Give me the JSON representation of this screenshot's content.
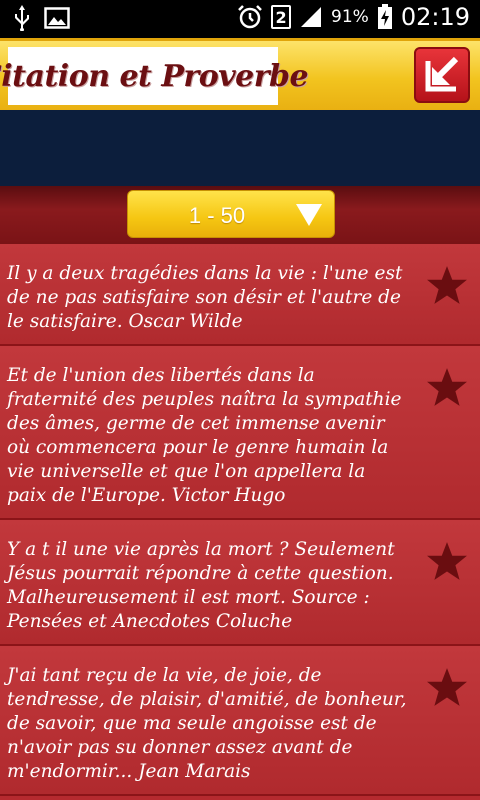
{
  "status_bar": {
    "battery": "91%",
    "time": "02:19",
    "sim": "2"
  },
  "header": {
    "logo_text": "Citation et Proverbe"
  },
  "range_selector": {
    "selected": "1 - 50"
  },
  "quotes": [
    {
      "text": "Il y a deux tragédies dans la vie : l'une est de ne pas satisfaire son désir et l'autre de le satisfaire. Oscar Wilde"
    },
    {
      "text": "Et de l'union des libertés dans la fraternité des peuples naîtra la sympathie des âmes, germe de cet immense avenir où commencera pour le genre humain la vie universelle et que l'on appellera la paix de l'Europe. Victor Hugo"
    },
    {
      "text": "Y a t il une vie après la mort ? Seulement Jésus pourrait répondre à cette question. Malheureusement il est mort. Source : Pensées et Anecdotes Coluche"
    },
    {
      "text": "J'ai tant reçu de la vie, de joie, de tendresse, de plaisir, d'amitié, de bonheur, de savoir, que ma seule angoisse est de n'avoir pas su donner assez avant de m'endormir... Jean Marais"
    }
  ],
  "colors": {
    "header_yellow": "#f2c41f",
    "banner_navy": "#0c1e3c",
    "list_red": "#b52a2f",
    "star_dark": "#6a0d10"
  }
}
